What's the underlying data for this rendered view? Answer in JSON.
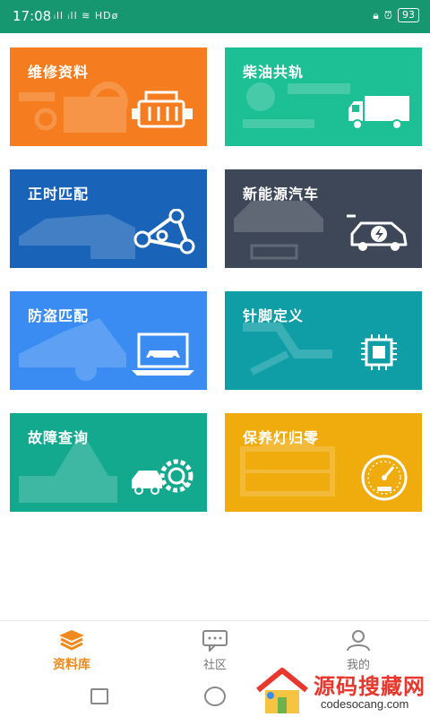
{
  "status": {
    "time": "17:08",
    "signal": "ᵢll ᵢll ≋ HDø",
    "battery": "93"
  },
  "tiles": [
    {
      "label": "维修资料",
      "color": "#f57c1f"
    },
    {
      "label": "柴油共轨",
      "color": "#1dbf95"
    },
    {
      "label": "正时匹配",
      "color": "#1963b8"
    },
    {
      "label": "新能源汽车",
      "color": "#3d4757"
    },
    {
      "label": "防盗匹配",
      "color": "#3a8cf2"
    },
    {
      "label": "针脚定义",
      "color": "#0f9ea6"
    },
    {
      "label": "故障查询",
      "color": "#13a98e"
    },
    {
      "label": "保养灯归零",
      "color": "#f0ab0c"
    }
  ],
  "bottom_nav": [
    {
      "label": "资料库",
      "active": true
    },
    {
      "label": "社区",
      "active": false
    },
    {
      "label": "我的",
      "active": false
    }
  ],
  "watermark": {
    "title": "源码搜藏网",
    "url": "codesocang.com"
  },
  "colors": {
    "statusbar": "#17976f",
    "nav_active": "#f08a1d"
  }
}
